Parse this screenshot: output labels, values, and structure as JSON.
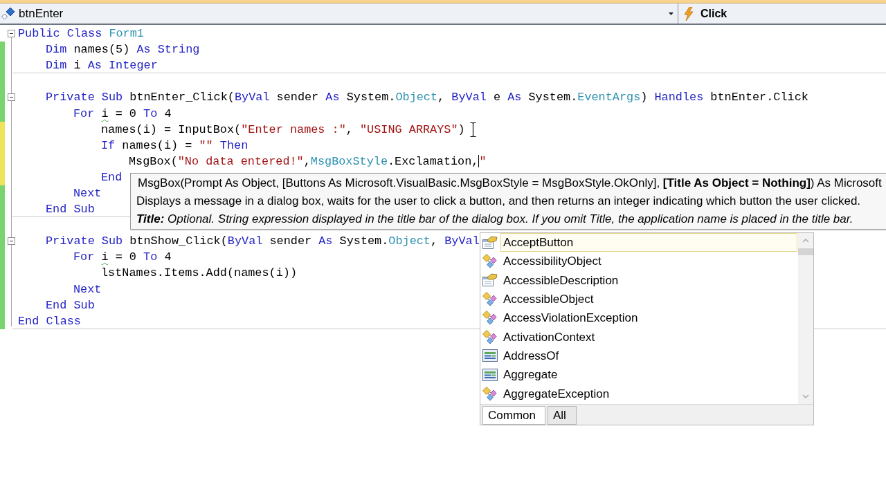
{
  "class_dropdown": {
    "value": "btnEnter"
  },
  "method_dropdown": {
    "value": "Click"
  },
  "code": [
    {
      "tokens": [
        {
          "kind": "keyword",
          "text": "Public Class"
        },
        {
          "kind": "type",
          "text": " Form1"
        }
      ],
      "changed": false,
      "expanded": true,
      "children": [
        {
          "tokens": [
            {
              "kind": "keyword",
              "text": "Dim"
            },
            {
              "kind": "plain",
              "text": " names(5) "
            },
            {
              "kind": "keyword",
              "text": "As String"
            }
          ],
          "changed": true,
          "saved": true
        },
        {
          "tokens": [
            {
              "kind": "keyword",
              "text": "Dim"
            },
            {
              "kind": "plain",
              "text": " i "
            },
            {
              "kind": "keyword",
              "text": "As Integer"
            }
          ],
          "changed": true,
          "saved": true,
          "rule_below": true
        },
        {
          "changed": true,
          "saved": true
        },
        {
          "tokens": [
            {
              "kind": "keyword",
              "text": "Private Sub"
            },
            {
              "kind": "plain",
              "text": " btnEnter_Click("
            },
            {
              "kind": "keyword",
              "text": "ByVal"
            },
            {
              "kind": "plain",
              "text": " sender "
            },
            {
              "kind": "keyword",
              "text": "As"
            },
            {
              "kind": "plain",
              "text": " System."
            },
            {
              "kind": "type",
              "text": "Object"
            },
            {
              "kind": "plain",
              "text": ", "
            },
            {
              "kind": "keyword",
              "text": "ByVal"
            },
            {
              "kind": "plain",
              "text": " e "
            },
            {
              "kind": "keyword",
              "text": "As"
            },
            {
              "kind": "plain",
              "text": " System."
            },
            {
              "kind": "type",
              "text": "EventArgs"
            },
            {
              "kind": "plain",
              "text": ") "
            },
            {
              "kind": "keyword",
              "text": "Handles"
            },
            {
              "kind": "plain",
              "text": " btnEnter.Click"
            }
          ],
          "changed": true,
          "saved": true,
          "expanded": true,
          "children": [
            {
              "tokens": [
                {
                  "kind": "keyword",
                  "text": "For "
                },
                {
                  "kind": "warning",
                  "text": "i"
                },
                {
                  "kind": "plain",
                  "text": " = 0 "
                },
                {
                  "kind": "keyword",
                  "text": "To"
                },
                {
                  "kind": "plain",
                  "text": " 4"
                }
              ],
              "changed": true,
              "saved": true,
              "children": [
                {
                  "tokens": [
                    {
                      "kind": "plain",
                      "text": "names(i) = InputBox("
                    },
                    {
                      "kind": "string",
                      "text": "\"Enter names :\""
                    },
                    {
                      "kind": "plain",
                      "text": ", "
                    },
                    {
                      "kind": "string",
                      "text": "\"USING ARRAYS\""
                    },
                    {
                      "kind": "plain",
                      "text": ")"
                    },
                    {
                      "kind": "pointer"
                    }
                  ],
                  "changed": true,
                  "saved": false
                },
                {
                  "tokens": [
                    {
                      "kind": "keyword",
                      "text": "If"
                    },
                    {
                      "kind": "plain",
                      "text": " names(i) = "
                    },
                    {
                      "kind": "string",
                      "text": "\"\""
                    },
                    {
                      "kind": "keyword",
                      "text": " Then"
                    }
                  ],
                  "changed": true,
                  "saved": false,
                  "children": [
                    {
                      "tokens": [
                        {
                          "kind": "plain",
                          "text": "MsgBox("
                        },
                        {
                          "kind": "string",
                          "text": "\"No data entered!\""
                        },
                        {
                          "kind": "plain",
                          "text": ","
                        },
                        {
                          "kind": "type",
                          "text": "MsgBoxStyle"
                        },
                        {
                          "kind": "plain",
                          "text": ".Exclamation,"
                        },
                        {
                          "kind": "cursor"
                        },
                        {
                          "kind": "string",
                          "text": "\""
                        }
                      ],
                      "changed": true,
                      "saved": false
                    }
                  ]
                },
                {
                  "tokens": [
                    {
                      "kind": "keyword",
                      "text": "End"
                    }
                  ],
                  "changed": true,
                  "saved": false
                }
              ]
            },
            {
              "tokens": [
                {
                  "kind": "keyword",
                  "text": "Next"
                }
              ],
              "changed": true,
              "saved": true
            }
          ]
        },
        {
          "tokens": [
            {
              "kind": "keyword",
              "text": "End Sub"
            }
          ],
          "changed": true,
          "saved": true,
          "rule_below": true
        },
        {
          "changed": true,
          "saved": true
        },
        {
          "tokens": [
            {
              "kind": "keyword",
              "text": "Private Sub"
            },
            {
              "kind": "plain",
              "text": " btnShow_Click("
            },
            {
              "kind": "keyword",
              "text": "ByVal"
            },
            {
              "kind": "plain",
              "text": " sender "
            },
            {
              "kind": "keyword",
              "text": "As"
            },
            {
              "kind": "plain",
              "text": " System."
            },
            {
              "kind": "type",
              "text": "Object"
            },
            {
              "kind": "plain",
              "text": ", "
            },
            {
              "kind": "keyword",
              "text": "ByVal"
            }
          ],
          "changed": true,
          "saved": true,
          "expanded": true,
          "children": [
            {
              "tokens": [
                {
                  "kind": "keyword",
                  "text": "For "
                },
                {
                  "kind": "warning",
                  "text": "i"
                },
                {
                  "kind": "plain",
                  "text": " = 0 "
                },
                {
                  "kind": "keyword",
                  "text": "To"
                },
                {
                  "kind": "plain",
                  "text": " 4"
                }
              ],
              "changed": true,
              "saved": true,
              "children": [
                {
                  "tokens": [
                    {
                      "kind": "plain",
                      "text": "lstNames.Items.Add(names(i))"
                    }
                  ],
                  "changed": true,
                  "saved": true
                }
              ]
            },
            {
              "tokens": [
                {
                  "kind": "keyword",
                  "text": "Next"
                }
              ],
              "changed": true,
              "saved": true
            }
          ]
        },
        {
          "tokens": [
            {
              "kind": "keyword",
              "text": "End Sub"
            }
          ],
          "changed": true,
          "saved": true
        }
      ]
    },
    {
      "tokens": [
        {
          "kind": "keyword",
          "text": "End Class"
        }
      ],
      "changed": true,
      "saved": true,
      "rule_below": true
    }
  ],
  "tooltip": {
    "signature": "MsgBox(Prompt As Object, [Buttons As Microsoft.VisualBasic.MsgBoxStyle = MsgBoxStyle.OkOnly], **[Title As Object = Nothing]**) As Microsoft",
    "description": "Displays a message in a dialog box, waits for the user to click a button, and then returns an integer indicating which button the user clicked.",
    "parameter": "**Title:** Optional. String expression displayed in the title bar of the dialog box. If you omit Title, the application name is placed in the title bar."
  },
  "completion": {
    "items": [
      {
        "label": "AcceptButton",
        "kind": "property",
        "selected": true
      },
      {
        "label": "AccessibilityObject",
        "kind": "class",
        "selected": false
      },
      {
        "label": "AccessibleDescription",
        "kind": "property",
        "selected": false
      },
      {
        "label": "AccessibleObject",
        "kind": "class",
        "selected": false
      },
      {
        "label": "AccessViolationException",
        "kind": "class",
        "selected": false
      },
      {
        "label": "ActivationContext",
        "kind": "class",
        "selected": false
      },
      {
        "label": "AddressOf",
        "kind": "keyword",
        "selected": false
      },
      {
        "label": "Aggregate",
        "kind": "keyword",
        "selected": false
      },
      {
        "label": "AggregateException",
        "kind": "class",
        "selected": false
      }
    ],
    "tabs": [
      {
        "label": "Common",
        "selected": true
      },
      {
        "label": "All",
        "selected": false
      }
    ]
  }
}
